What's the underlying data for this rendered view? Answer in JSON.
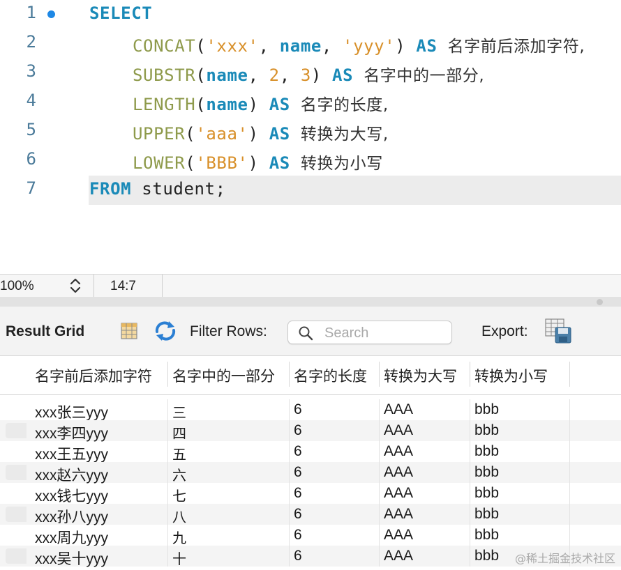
{
  "editor": {
    "lines": [
      {
        "num": "1"
      },
      {
        "num": "2"
      },
      {
        "num": "3"
      },
      {
        "num": "4"
      },
      {
        "num": "5"
      },
      {
        "num": "6"
      },
      {
        "num": "7"
      }
    ],
    "tokens": {
      "select": "SELECT",
      "l2_fn": "CONCAT",
      "l2_p1": "(",
      "l2_s1": "'xxx'",
      "l2_c1": ", ",
      "l2_col": "name",
      "l2_c2": ", ",
      "l2_s2": "'yyy'",
      "l2_p2": ")",
      "l2_as": "AS",
      "l2_alias": "名字前后添加字符,",
      "l3_fn": "SUBSTR",
      "l3_p1": "(",
      "l3_col": "name",
      "l3_c1": ", ",
      "l3_n1": "2",
      "l3_c2": ", ",
      "l3_n2": "3",
      "l3_p2": ")",
      "l3_as": "AS",
      "l3_alias": "名字中的一部分,",
      "l4_fn": "LENGTH",
      "l4_p1": "(",
      "l4_col": "name",
      "l4_p2": ")",
      "l4_as": "AS",
      "l4_alias": "名字的长度,",
      "l5_fn": "UPPER",
      "l5_p1": "(",
      "l5_s1": "'aaa'",
      "l5_p2": ")",
      "l5_as": "AS",
      "l5_alias": "转换为大写,",
      "l6_fn": "LOWER",
      "l6_p1": "(",
      "l6_s1": "'BBB'",
      "l6_p2": ")",
      "l6_as": "AS",
      "l6_alias": "转换为小写",
      "from": "FROM",
      "table": "student;"
    }
  },
  "status": {
    "zoom": "100%",
    "cursor": "14:7"
  },
  "toolbar": {
    "result_grid": "Result Grid",
    "filter_rows": "Filter Rows:",
    "search_placeholder": "Search",
    "export": "Export:"
  },
  "grid": {
    "columns": [
      "名字前后添加字符",
      "名字中的一部分",
      "名字的长度",
      "转换为大写",
      "转换为小写"
    ],
    "rows": [
      [
        "xxx张三yyy",
        "三",
        "6",
        "AAA",
        "bbb"
      ],
      [
        "xxx李四yyy",
        "四",
        "6",
        "AAA",
        "bbb"
      ],
      [
        "xxx王五yyy",
        "五",
        "6",
        "AAA",
        "bbb"
      ],
      [
        "xxx赵六yyy",
        "六",
        "6",
        "AAA",
        "bbb"
      ],
      [
        "xxx钱七yyy",
        "七",
        "6",
        "AAA",
        "bbb"
      ],
      [
        "xxx孙八yyy",
        "八",
        "6",
        "AAA",
        "bbb"
      ],
      [
        "xxx周九yyy",
        "九",
        "6",
        "AAA",
        "bbb"
      ],
      [
        "xxx吴十yyy",
        "十",
        "6",
        "AAA",
        "bbb"
      ]
    ]
  },
  "watermark": "@稀土掘金技术社区",
  "colors": {
    "keyword": "#1a8ab8",
    "function": "#8e9a4b",
    "string": "#d8902a",
    "breakpoint": "#1e88e5"
  }
}
